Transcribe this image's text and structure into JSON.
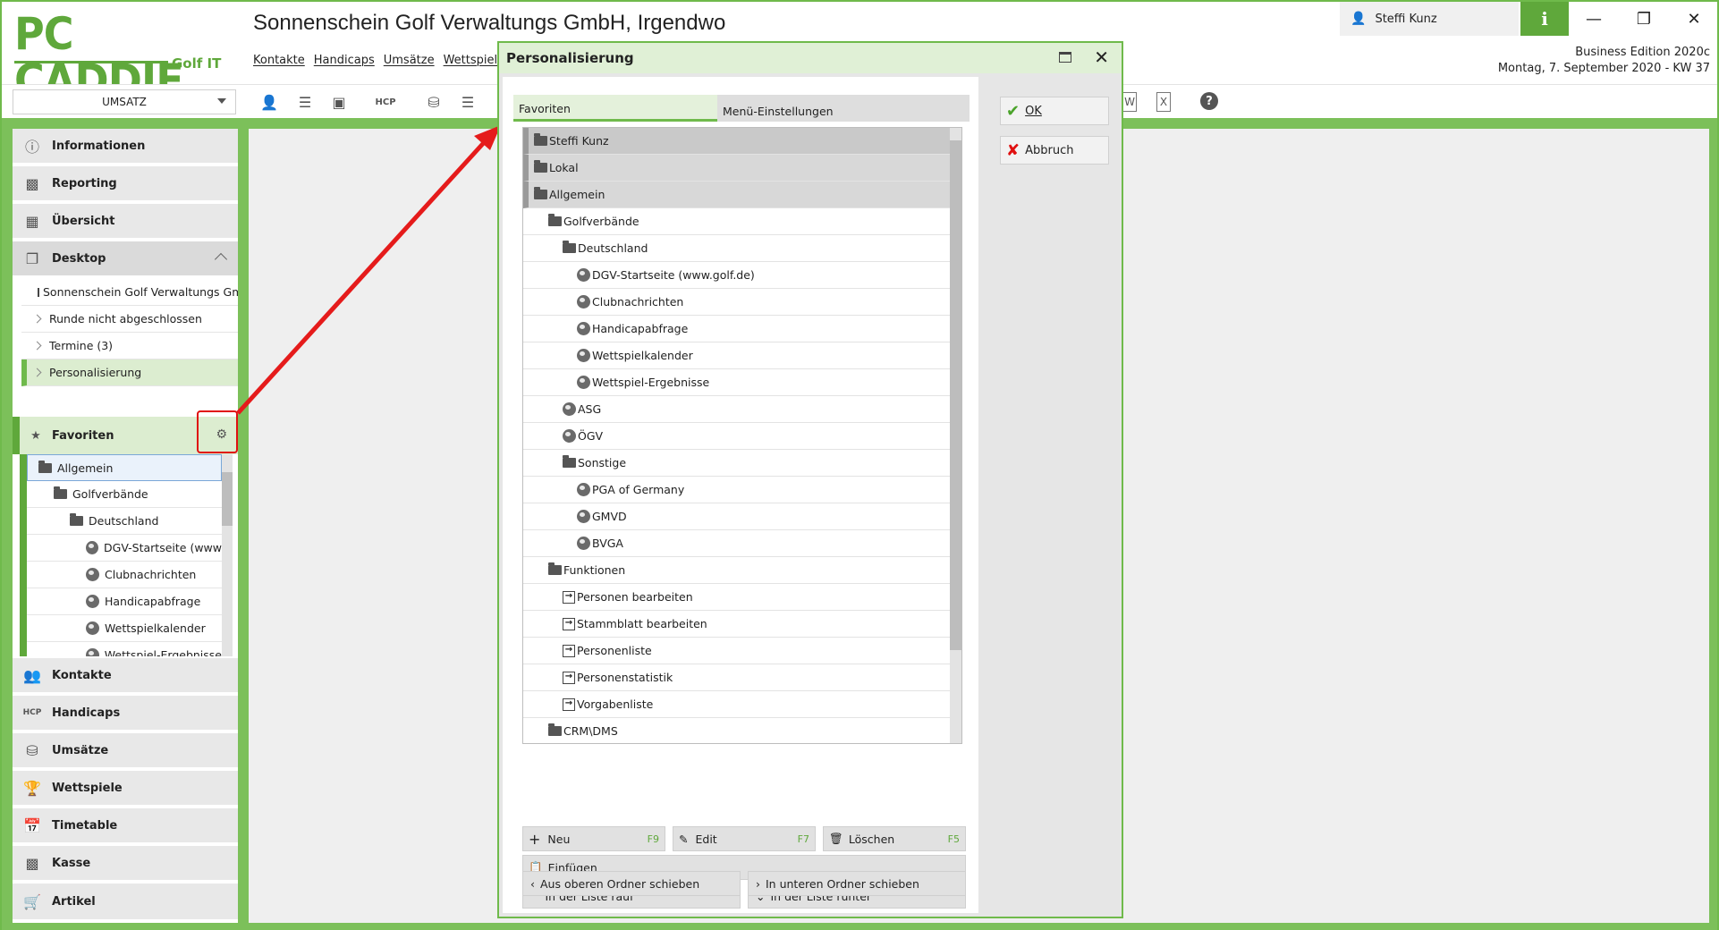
{
  "app": {
    "logo_text": "PC CADDIE",
    "logo_sub": "Golf IT",
    "title": "Sonnenschein Golf Verwaltungs GmbH, Irgendwo",
    "menu": [
      "Kontakte",
      "Handicaps",
      "Umsätze",
      "Wettspiele"
    ],
    "user": "Steffi Kunz",
    "edition": "Business Edition 2020c",
    "date": "Montag, 7. September 2020 - KW 37",
    "accent": "#5fa83b"
  },
  "toolbar": {
    "combo_value": "UMSATZ",
    "icons": [
      "person-icon",
      "list-icon",
      "card-icon",
      "hcp-icon",
      "coins-icon",
      "list2-icon",
      "word-icon",
      "excel-icon",
      "help-icon"
    ]
  },
  "sidebar": {
    "nav_top": [
      "Informationen",
      "Reporting",
      "Übersicht",
      "Desktop"
    ],
    "desktop_items": [
      "Sonnenschein Golf Verwaltungs Gm",
      "Runde nicht abgeschlossen",
      "Termine (3)",
      "Personalisierung"
    ],
    "favorites_label": "Favoriten",
    "fav_tree": [
      {
        "label": "Allgemein",
        "indent": 0,
        "icon": "folder"
      },
      {
        "label": "Golfverbände",
        "indent": 1,
        "icon": "folder"
      },
      {
        "label": "Deutschland",
        "indent": 2,
        "icon": "folder"
      },
      {
        "label": "DGV-Startseite (www",
        "indent": 3,
        "icon": "globe"
      },
      {
        "label": "Clubnachrichten",
        "indent": 3,
        "icon": "globe"
      },
      {
        "label": "Handicapabfrage",
        "indent": 3,
        "icon": "globe"
      },
      {
        "label": "Wettspielkalender",
        "indent": 3,
        "icon": "globe"
      },
      {
        "label": "Wettspiel-Ergebnisse",
        "indent": 3,
        "icon": "globe"
      }
    ],
    "nav_bottom": [
      "Kontakte",
      "Handicaps",
      "Umsätze",
      "Wettspiele",
      "Timetable",
      "Kasse",
      "Artikel"
    ]
  },
  "dialog": {
    "title": "Personalisierung",
    "tabs": [
      "Favoriten",
      "Menü-Einstellungen"
    ],
    "ok": "OK",
    "cancel": "Abbruch",
    "tree": [
      {
        "label": "Steffi Kunz",
        "indent": 0,
        "icon": "folder",
        "hl": "dark"
      },
      {
        "label": "Lokal",
        "indent": 0,
        "icon": "folder",
        "hl": "mid"
      },
      {
        "label": "Allgemein",
        "indent": 0,
        "icon": "folder",
        "hl": "mid"
      },
      {
        "label": "Golfverbände",
        "indent": 1,
        "icon": "folder"
      },
      {
        "label": "Deutschland",
        "indent": 2,
        "icon": "folder"
      },
      {
        "label": "DGV-Startseite (www.golf.de)",
        "indent": 3,
        "icon": "globe"
      },
      {
        "label": "Clubnachrichten",
        "indent": 3,
        "icon": "globe"
      },
      {
        "label": "Handicapabfrage",
        "indent": 3,
        "icon": "globe"
      },
      {
        "label": "Wettspielkalender",
        "indent": 3,
        "icon": "globe"
      },
      {
        "label": "Wettspiel-Ergebnisse",
        "indent": 3,
        "icon": "globe"
      },
      {
        "label": "ASG",
        "indent": 2,
        "icon": "globe"
      },
      {
        "label": "ÖGV",
        "indent": 2,
        "icon": "globe"
      },
      {
        "label": "Sonstige",
        "indent": 2,
        "icon": "folder"
      },
      {
        "label": "PGA of Germany",
        "indent": 3,
        "icon": "globe"
      },
      {
        "label": "GMVD",
        "indent": 3,
        "icon": "globe"
      },
      {
        "label": "BVGA",
        "indent": 3,
        "icon": "globe"
      },
      {
        "label": "Funktionen",
        "indent": 1,
        "icon": "folder"
      },
      {
        "label": "Personen bearbeiten",
        "indent": 2,
        "icon": "fn"
      },
      {
        "label": "Stammblatt bearbeiten",
        "indent": 2,
        "icon": "fn"
      },
      {
        "label": "Personenliste",
        "indent": 2,
        "icon": "fn"
      },
      {
        "label": "Personenstatistik",
        "indent": 2,
        "icon": "fn"
      },
      {
        "label": "Vorgabenliste",
        "indent": 2,
        "icon": "fn"
      },
      {
        "label": "CRM\\DMS",
        "indent": 1,
        "icon": "folder"
      }
    ],
    "buttons": {
      "neu": "Neu",
      "neu_key": "F9",
      "edit": "Edit",
      "edit_key": "F7",
      "loeschen": "Löschen",
      "loeschen_key": "F5",
      "einfuegen": "Einfügen",
      "rauf": "In der Liste rauf",
      "runter": "In der Liste runter",
      "aus": "Aus oberen Ordner schieben",
      "in": "In unteren Ordner schieben"
    }
  }
}
